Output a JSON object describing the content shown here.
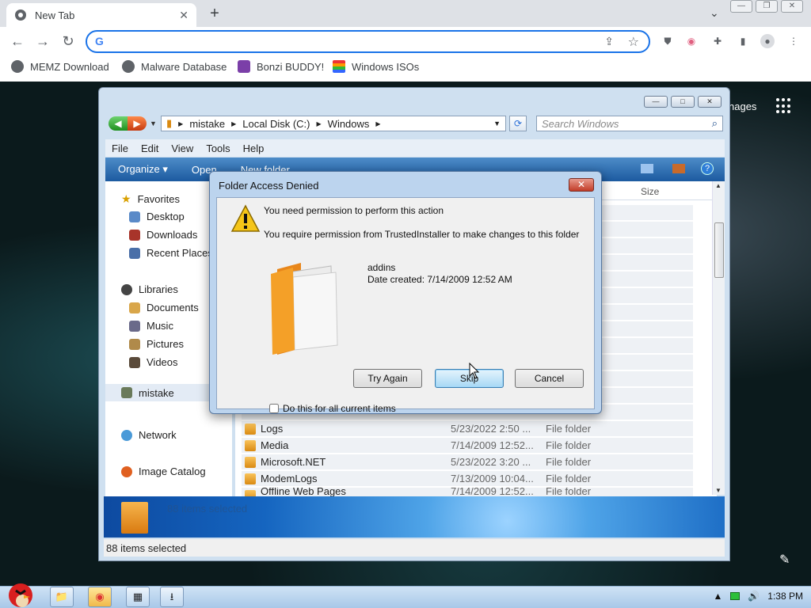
{
  "browser": {
    "tab": {
      "title": "New Tab"
    },
    "omnibox": {
      "value": "",
      "placeholder": ""
    },
    "bookmarks": [
      {
        "label": "MEMZ Download",
        "icon": "globe-icon"
      },
      {
        "label": "Malware Database",
        "icon": "globe-icon"
      },
      {
        "label": "Bonzi BUDDY!",
        "icon": "bonzi-icon"
      },
      {
        "label": "Windows ISOs",
        "icon": "windows-logo-icon"
      }
    ]
  },
  "newtab_page": {
    "images_label": "nages"
  },
  "explorer": {
    "address": [
      "mistake",
      "Local Disk (C:)",
      "Windows"
    ],
    "search_placeholder": "Search Windows",
    "menu": [
      "File",
      "Edit",
      "View",
      "Tools",
      "Help"
    ],
    "commands": [
      "Organize",
      "Open",
      "New folder"
    ],
    "column_header_size": "Size",
    "nav": {
      "favorites": "Favorites",
      "favorites_items": [
        "Desktop",
        "Downloads",
        "Recent Places"
      ],
      "libraries": "Libraries",
      "libraries_items": [
        "Documents",
        "Music",
        "Pictures",
        "Videos"
      ],
      "homegroup": "mistake",
      "network": "Network",
      "image_catalog": "Image Catalog"
    },
    "files": [
      {
        "name": "Logs",
        "date": "5/23/2022 2:50 ...",
        "type": "File folder"
      },
      {
        "name": "Media",
        "date": "7/14/2009 12:52...",
        "type": "File folder"
      },
      {
        "name": "Microsoft.NET",
        "date": "5/23/2022 3:20 ...",
        "type": "File folder"
      },
      {
        "name": "ModemLogs",
        "date": "7/13/2009 10:04...",
        "type": "File folder"
      },
      {
        "name": "Offline Web Pages",
        "date": "7/14/2009 12:52...",
        "type": "File folder"
      }
    ],
    "details_text": "88 items selected",
    "status": "88 items selected"
  },
  "dialog": {
    "title": "Folder Access Denied",
    "heading": "You need permission to perform this action",
    "message": "You require permission from TrustedInstaller to make changes to this folder",
    "item_name": "addins",
    "item_date": "Date created: 7/14/2009 12:52 AM",
    "buttons": {
      "try_again": "Try Again",
      "skip": "Skip",
      "cancel": "Cancel"
    },
    "checkbox": "Do this for all current items"
  },
  "taskbar": {
    "clock": "1:38 PM"
  }
}
